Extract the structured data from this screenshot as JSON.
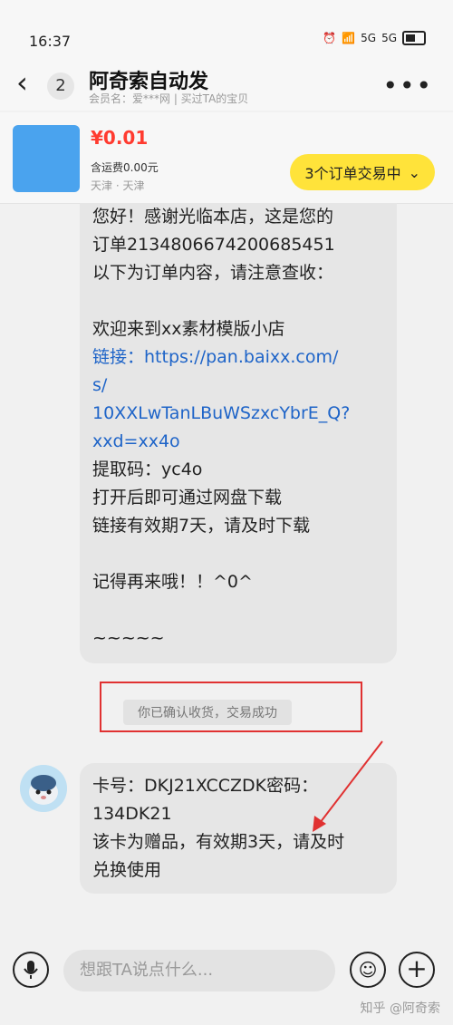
{
  "status_bar": {
    "time": "16:37",
    "signal1": "5G",
    "signal2": "5G"
  },
  "header": {
    "unread_count": "2",
    "title": "阿奇索自动发",
    "subtitle": "会员名：爱***网 | 买过TA的宝贝"
  },
  "product": {
    "price": "¥0.01",
    "shipping": "含运费0.00元",
    "location": "天津 · 天津",
    "orders_button": "3个订单交易中"
  },
  "messages": {
    "first": [
      "您好！感谢光临本店，这是您的",
      "订单2134806674200685451",
      "以下为订单内容，请注意查收：",
      "",
      "欢迎来到xx素材模版小店",
      "链接：https://pan.baixx.com/",
      "s/",
      "10XXLwTanLBuWSzxcYbrE_Q?",
      "xxd=xx4o",
      "提取码：yc4o",
      "打开后即可通过网盘下载",
      "链接有效期7天，请及时下载",
      "",
      "记得再来哦！！^0^",
      "",
      "~~~~~"
    ],
    "system": "你已确认收货，交易成功",
    "second": [
      "卡号：DKJ21XCCZDK密码：",
      "134DK21",
      "该卡为赠品，有效期3天，请及时",
      "兑换使用"
    ]
  },
  "input_bar": {
    "placeholder": "想跟TA说点什么..."
  },
  "watermark": "知乎 @阿奇索",
  "colors": {
    "accent": "#ffe33a",
    "price": "#ff3b30",
    "link": "#1e64c8",
    "highlight": "#e03131"
  }
}
